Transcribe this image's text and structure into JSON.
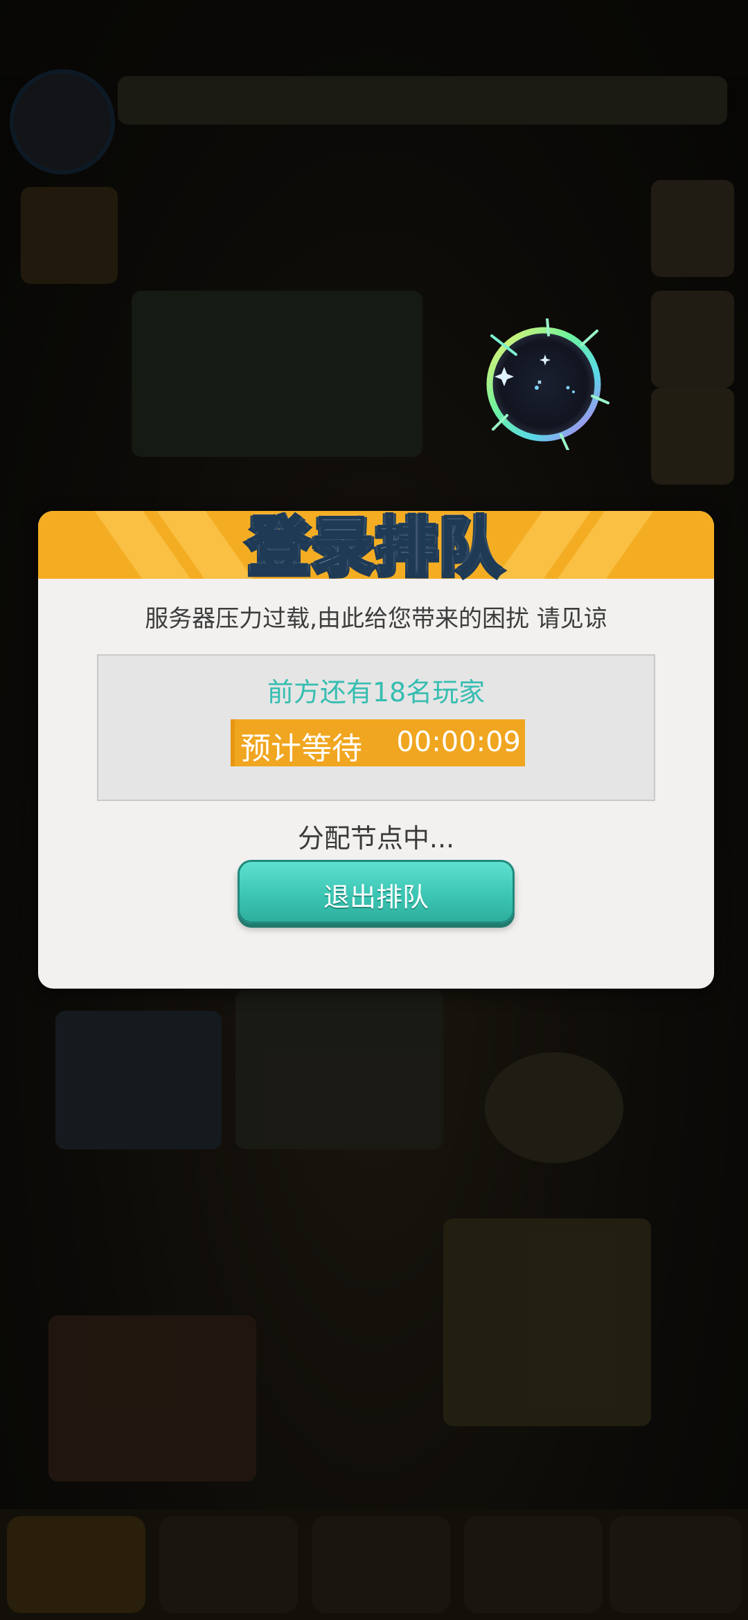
{
  "dialog": {
    "title": "登录排队",
    "message": "服务器压力过载,由此给您带来的困扰 请见谅",
    "queue_count_text": "前方还有18名玩家",
    "wait_label": "预计等待",
    "wait_time": "00:00:09",
    "status_text": "分配节点中...",
    "exit_button_label": "退出排队"
  },
  "colors": {
    "header": "#f4ad22",
    "accent_teal": "#36bdb1",
    "wait_bar": "#f0a620",
    "dialog_bg": "#f2f1ef"
  },
  "icons": {
    "loading": "sparkle-orb-icon"
  }
}
